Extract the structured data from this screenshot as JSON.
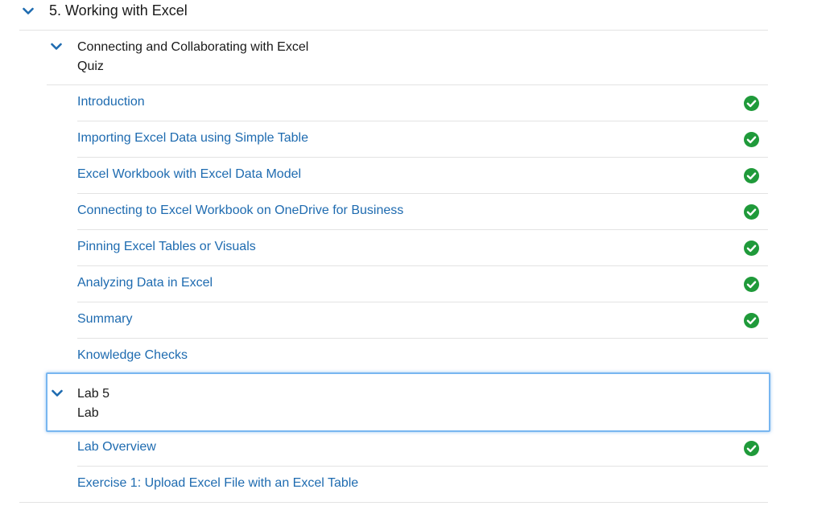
{
  "colors": {
    "accent": "#1e6bb0",
    "check": "#1f9a3a",
    "focus_border": "#78b6f0",
    "divider": "#e3e3e3"
  },
  "section": {
    "title": "5. Working with Excel",
    "icon": "chevron-down-icon"
  },
  "group_quiz": {
    "title": "Connecting and Collaborating with Excel",
    "subtitle": "Quiz",
    "icon": "chevron-down-icon",
    "items": [
      {
        "label": "Introduction",
        "completed": true
      },
      {
        "label": "Importing Excel Data using Simple Table",
        "completed": true
      },
      {
        "label": "Excel Workbook with Excel Data Model",
        "completed": true
      },
      {
        "label": "Connecting to Excel Workbook on OneDrive for Business",
        "completed": true
      },
      {
        "label": "Pinning Excel Tables or Visuals",
        "completed": true
      },
      {
        "label": "Analyzing Data in Excel",
        "completed": true
      },
      {
        "label": "Summary",
        "completed": true
      },
      {
        "label": "Knowledge Checks",
        "completed": false
      }
    ]
  },
  "group_lab": {
    "title": "Lab 5",
    "subtitle": "Lab",
    "icon": "chevron-down-icon",
    "items": [
      {
        "label": "Lab Overview",
        "completed": true
      },
      {
        "label": "Exercise 1: Upload Excel File with an Excel Table",
        "completed": false
      }
    ]
  }
}
